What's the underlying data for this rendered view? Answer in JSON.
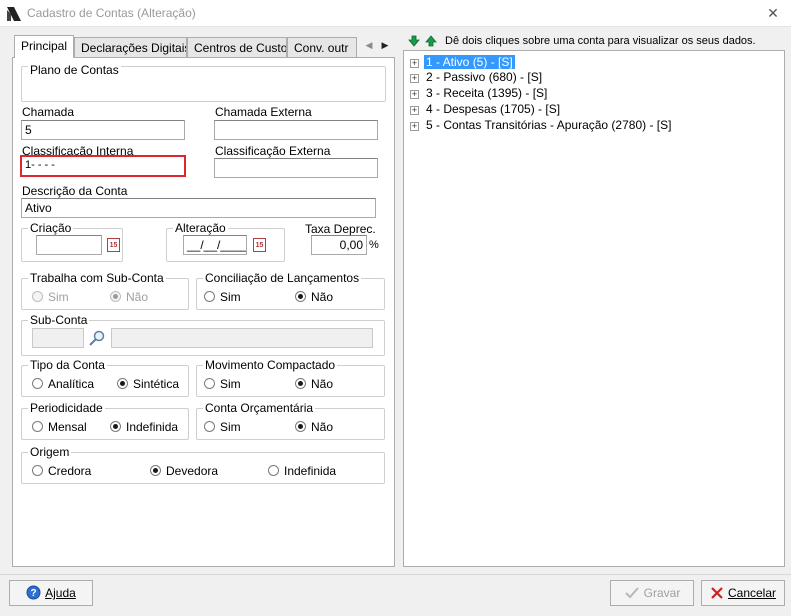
{
  "window": {
    "title": "Cadastro de Contas (Alteração)",
    "close": "✕"
  },
  "tabs": [
    {
      "label": "Principal"
    },
    {
      "label": "Declarações Digitais"
    },
    {
      "label": "Centros de Custo"
    },
    {
      "label": "Conv. outr"
    }
  ],
  "form": {
    "plano_contas": {
      "legend": "Plano de Contas"
    },
    "chamada": {
      "label": "Chamada",
      "value": "5"
    },
    "chamada_externa": {
      "label": "Chamada Externa",
      "value": ""
    },
    "classificacao_interna": {
      "label": "Classificação Interna",
      "value": "1- -  -  -"
    },
    "classificacao_externa": {
      "label": "Classificação Externa",
      "value": ""
    },
    "descricao": {
      "label": "Descrição da Conta",
      "value": "Ativo"
    },
    "criacao": {
      "legend": "Criação",
      "value": ""
    },
    "alteracao": {
      "legend": "Alteração",
      "value": "__/__/____"
    },
    "taxa_deprec": {
      "label": "Taxa Deprec.",
      "value": "0,00",
      "unit": "%"
    },
    "trabalha_sub_conta": {
      "legend": "Trabalha com Sub-Conta",
      "opt1": "Sim",
      "opt2": "Não"
    },
    "conciliacao": {
      "legend": "Conciliação de Lançamentos",
      "opt1": "Sim",
      "opt2": "Não"
    },
    "sub_conta": {
      "legend": "Sub-Conta"
    },
    "tipo_conta": {
      "legend": "Tipo da Conta",
      "opt1": "Analítica",
      "opt2": "Sintética"
    },
    "movimento": {
      "legend": "Movimento Compactado",
      "opt1": "Sim",
      "opt2": "Não"
    },
    "periodicidade": {
      "legend": "Periodicidade",
      "opt1": "Mensal",
      "opt2": "Indefinida"
    },
    "conta_orcamentaria": {
      "legend": "Conta Orçamentária",
      "opt1": "Sim",
      "opt2": "Não"
    },
    "origem": {
      "legend": "Origem",
      "opt1": "Credora",
      "opt2": "Devedora",
      "opt3": "Indefinida"
    }
  },
  "tree": {
    "hint": "Dê dois cliques sobre uma conta para visualizar os seus dados.",
    "items": [
      {
        "label": "1 - Ativo (5) - [S]"
      },
      {
        "label": "2 - Passivo (680) - [S]"
      },
      {
        "label": "3 - Receita (1395) - [S]"
      },
      {
        "label": "4 - Despesas (1705) - [S]"
      },
      {
        "label": "5 - Contas Transitórias  - Apuração (2780) - [S]"
      }
    ]
  },
  "buttons": {
    "ajuda": "Ajuda",
    "gravar": "Gravar",
    "cancelar": "Cancelar"
  },
  "colors": {
    "selection": "#3399ff",
    "highlight_border": "#e0262d",
    "arrow_green": "#1a9a4a"
  }
}
